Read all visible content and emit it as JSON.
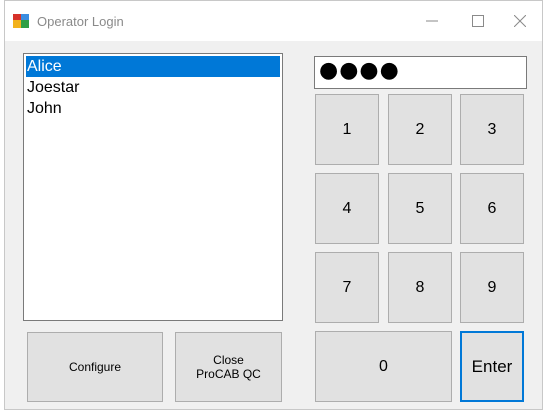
{
  "window": {
    "title": "Operator Login"
  },
  "operators": [
    "Alice",
    "Joestar",
    "John"
  ],
  "selected_operator_index": 0,
  "password": {
    "masked": "●●●●"
  },
  "keypad": {
    "k1": "1",
    "k2": "2",
    "k3": "3",
    "k4": "4",
    "k5": "5",
    "k6": "6",
    "k7": "7",
    "k8": "8",
    "k9": "9",
    "k0": "0",
    "enter": "Enter"
  },
  "buttons": {
    "configure": "Configure",
    "close_line1": "Close",
    "close_line2": "ProCAB QC"
  },
  "colors": {
    "selection": "#0078d7",
    "button_bg": "#e1e1e1",
    "window_bg": "#f0f0f0"
  }
}
